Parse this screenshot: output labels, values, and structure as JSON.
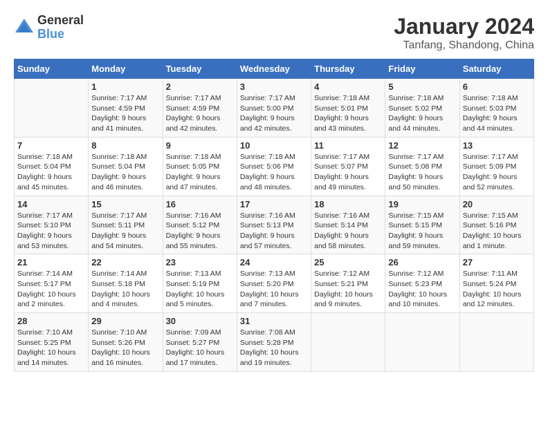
{
  "logo": {
    "general": "General",
    "blue": "Blue"
  },
  "title": "January 2024",
  "location": "Tanfang, Shandong, China",
  "days_header": [
    "Sunday",
    "Monday",
    "Tuesday",
    "Wednesday",
    "Thursday",
    "Friday",
    "Saturday"
  ],
  "weeks": [
    [
      {
        "day": "",
        "info": ""
      },
      {
        "day": "1",
        "info": "Sunrise: 7:17 AM\nSunset: 4:59 PM\nDaylight: 9 hours\nand 41 minutes."
      },
      {
        "day": "2",
        "info": "Sunrise: 7:17 AM\nSunset: 4:59 PM\nDaylight: 9 hours\nand 42 minutes."
      },
      {
        "day": "3",
        "info": "Sunrise: 7:17 AM\nSunset: 5:00 PM\nDaylight: 9 hours\nand 42 minutes."
      },
      {
        "day": "4",
        "info": "Sunrise: 7:18 AM\nSunset: 5:01 PM\nDaylight: 9 hours\nand 43 minutes."
      },
      {
        "day": "5",
        "info": "Sunrise: 7:18 AM\nSunset: 5:02 PM\nDaylight: 9 hours\nand 44 minutes."
      },
      {
        "day": "6",
        "info": "Sunrise: 7:18 AM\nSunset: 5:03 PM\nDaylight: 9 hours\nand 44 minutes."
      }
    ],
    [
      {
        "day": "7",
        "info": "Sunrise: 7:18 AM\nSunset: 5:04 PM\nDaylight: 9 hours\nand 45 minutes."
      },
      {
        "day": "8",
        "info": "Sunrise: 7:18 AM\nSunset: 5:04 PM\nDaylight: 9 hours\nand 46 minutes."
      },
      {
        "day": "9",
        "info": "Sunrise: 7:18 AM\nSunset: 5:05 PM\nDaylight: 9 hours\nand 47 minutes."
      },
      {
        "day": "10",
        "info": "Sunrise: 7:18 AM\nSunset: 5:06 PM\nDaylight: 9 hours\nand 48 minutes."
      },
      {
        "day": "11",
        "info": "Sunrise: 7:17 AM\nSunset: 5:07 PM\nDaylight: 9 hours\nand 49 minutes."
      },
      {
        "day": "12",
        "info": "Sunrise: 7:17 AM\nSunset: 5:08 PM\nDaylight: 9 hours\nand 50 minutes."
      },
      {
        "day": "13",
        "info": "Sunrise: 7:17 AM\nSunset: 5:09 PM\nDaylight: 9 hours\nand 52 minutes."
      }
    ],
    [
      {
        "day": "14",
        "info": "Sunrise: 7:17 AM\nSunset: 5:10 PM\nDaylight: 9 hours\nand 53 minutes."
      },
      {
        "day": "15",
        "info": "Sunrise: 7:17 AM\nSunset: 5:11 PM\nDaylight: 9 hours\nand 54 minutes."
      },
      {
        "day": "16",
        "info": "Sunrise: 7:16 AM\nSunset: 5:12 PM\nDaylight: 9 hours\nand 55 minutes."
      },
      {
        "day": "17",
        "info": "Sunrise: 7:16 AM\nSunset: 5:13 PM\nDaylight: 9 hours\nand 57 minutes."
      },
      {
        "day": "18",
        "info": "Sunrise: 7:16 AM\nSunset: 5:14 PM\nDaylight: 9 hours\nand 58 minutes."
      },
      {
        "day": "19",
        "info": "Sunrise: 7:15 AM\nSunset: 5:15 PM\nDaylight: 9 hours\nand 59 minutes."
      },
      {
        "day": "20",
        "info": "Sunrise: 7:15 AM\nSunset: 5:16 PM\nDaylight: 10 hours\nand 1 minute."
      }
    ],
    [
      {
        "day": "21",
        "info": "Sunrise: 7:14 AM\nSunset: 5:17 PM\nDaylight: 10 hours\nand 2 minutes."
      },
      {
        "day": "22",
        "info": "Sunrise: 7:14 AM\nSunset: 5:18 PM\nDaylight: 10 hours\nand 4 minutes."
      },
      {
        "day": "23",
        "info": "Sunrise: 7:13 AM\nSunset: 5:19 PM\nDaylight: 10 hours\nand 5 minutes."
      },
      {
        "day": "24",
        "info": "Sunrise: 7:13 AM\nSunset: 5:20 PM\nDaylight: 10 hours\nand 7 minutes."
      },
      {
        "day": "25",
        "info": "Sunrise: 7:12 AM\nSunset: 5:21 PM\nDaylight: 10 hours\nand 9 minutes."
      },
      {
        "day": "26",
        "info": "Sunrise: 7:12 AM\nSunset: 5:23 PM\nDaylight: 10 hours\nand 10 minutes."
      },
      {
        "day": "27",
        "info": "Sunrise: 7:11 AM\nSunset: 5:24 PM\nDaylight: 10 hours\nand 12 minutes."
      }
    ],
    [
      {
        "day": "28",
        "info": "Sunrise: 7:10 AM\nSunset: 5:25 PM\nDaylight: 10 hours\nand 14 minutes."
      },
      {
        "day": "29",
        "info": "Sunrise: 7:10 AM\nSunset: 5:26 PM\nDaylight: 10 hours\nand 16 minutes."
      },
      {
        "day": "30",
        "info": "Sunrise: 7:09 AM\nSunset: 5:27 PM\nDaylight: 10 hours\nand 17 minutes."
      },
      {
        "day": "31",
        "info": "Sunrise: 7:08 AM\nSunset: 5:28 PM\nDaylight: 10 hours\nand 19 minutes."
      },
      {
        "day": "",
        "info": ""
      },
      {
        "day": "",
        "info": ""
      },
      {
        "day": "",
        "info": ""
      }
    ]
  ]
}
